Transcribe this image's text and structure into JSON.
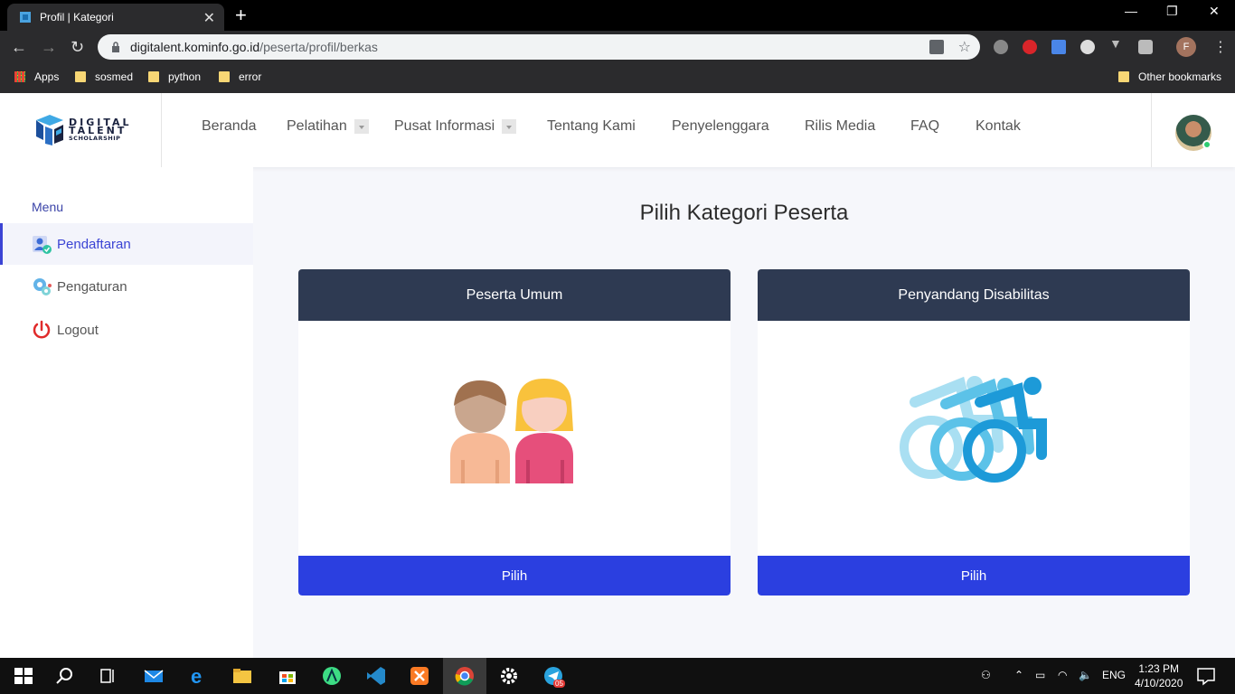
{
  "browser": {
    "tab_title": "Profil | Kategori",
    "new_tab": "+",
    "url_domain": "digitalent.kominfo.go.id",
    "url_path": "/peserta/profil/berkas",
    "profile_initial": "F",
    "bookmarks": [
      "Apps",
      "sosmed",
      "python",
      "error"
    ],
    "other_bookmarks": "Other bookmarks"
  },
  "header": {
    "logo_line1": "DIGITAL",
    "logo_line2": "TALENT",
    "logo_line3": "SCHOLARSHIP",
    "menu": [
      "Beranda",
      "Pelatihan",
      "Pusat Informasi",
      "Tentang Kami",
      "Penyelenggara",
      "Rilis Media",
      "FAQ",
      "Kontak"
    ]
  },
  "sidebar": {
    "title": "Menu",
    "items": [
      {
        "label": "Pendaftaran",
        "icon": "user-check-icon",
        "active": true
      },
      {
        "label": "Pengaturan",
        "icon": "gears-icon",
        "active": false
      },
      {
        "label": "Logout",
        "icon": "power-icon",
        "active": false
      }
    ]
  },
  "main": {
    "title": "Pilih Kategori Peserta",
    "cards": [
      {
        "title": "Peserta Umum",
        "icon": "two-people-icon",
        "button": "Pilih"
      },
      {
        "title": "Penyandang Disabilitas",
        "icon": "wheelchair-icon",
        "button": "Pilih"
      }
    ]
  },
  "taskbar": {
    "language": "ENG",
    "time": "1:23 PM",
    "date": "4/10/2020",
    "telegram_badge": "05"
  },
  "colors": {
    "accent": "#2b3fe0",
    "card_header": "#2e3a52",
    "sidebar_active": "#3b44d4"
  }
}
